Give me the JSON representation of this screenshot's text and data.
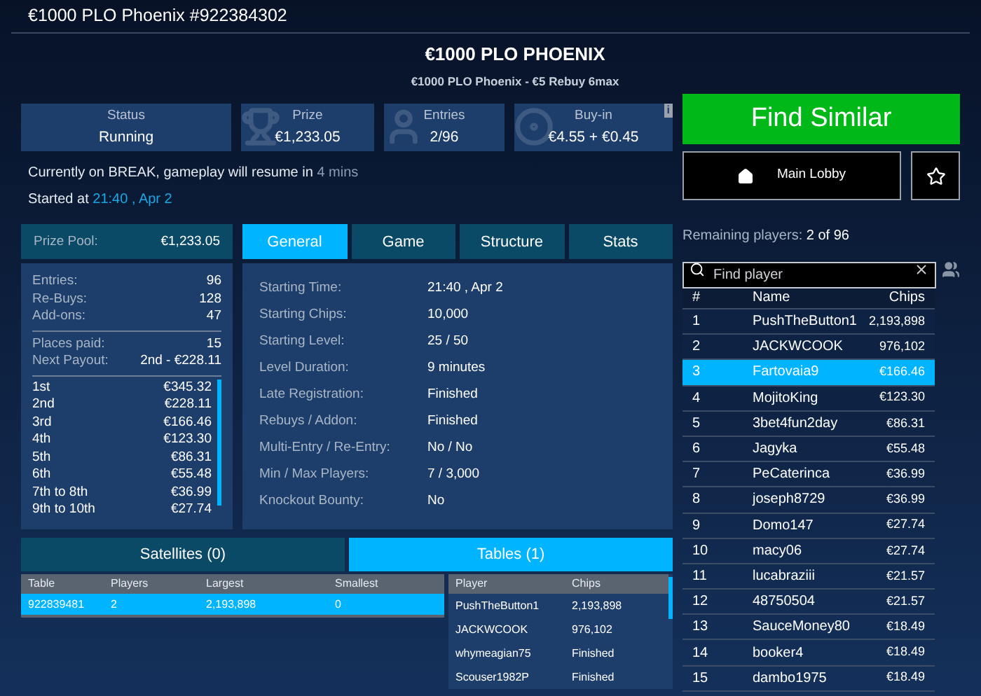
{
  "window": {
    "title": "€1000 PLO Phoenix #922384302"
  },
  "header": {
    "title": "€1000 PLO PHOENIX",
    "subtitle": "€1000 PLO Phoenix - €5 Rebuy 6max"
  },
  "stats": [
    {
      "kind": "plain",
      "label": "Status",
      "value": "Running"
    },
    {
      "kind": "trophy",
      "label": "Prize",
      "value": "€1,233.05"
    },
    {
      "kind": "people",
      "label": "Entries",
      "value": "2/96"
    },
    {
      "kind": "chip",
      "label": "Buy-in",
      "value": "€4.55 + €0.45",
      "info": "i"
    }
  ],
  "notice": {
    "text": "Currently on BREAK, gameplay will resume in",
    "highlight": "4 mins"
  },
  "started": {
    "label": "Started at",
    "value": "21:40 , Apr 2"
  },
  "prize_pool": {
    "label": "Prize Pool:",
    "value": "€1,233.05"
  },
  "counts": [
    {
      "label": "Entries:",
      "value": "96"
    },
    {
      "label": "Re-Buys:",
      "value": "128"
    },
    {
      "label": "Add-ons:",
      "value": "47"
    }
  ],
  "payout_info": [
    {
      "label": "Places paid:",
      "value": "15"
    },
    {
      "label": "Next Payout:",
      "value": "2nd - €228.11"
    }
  ],
  "payouts": [
    {
      "place": "1st",
      "amount": "€345.32"
    },
    {
      "place": "2nd",
      "amount": "€228.11"
    },
    {
      "place": "3rd",
      "amount": "€166.46"
    },
    {
      "place": "4th",
      "amount": "€123.30"
    },
    {
      "place": "5th",
      "amount": "€86.31"
    },
    {
      "place": "6th",
      "amount": "€55.48"
    },
    {
      "place": "7th to 8th",
      "amount": "€36.99"
    },
    {
      "place": "9th to 10th",
      "amount": "€27.74"
    }
  ],
  "tabs": [
    {
      "label": "General",
      "selected": true
    },
    {
      "label": "Game",
      "selected": false
    },
    {
      "label": "Structure",
      "selected": false
    },
    {
      "label": "Stats",
      "selected": false
    }
  ],
  "general": [
    {
      "label": "Starting Time:",
      "value": "21:40 , Apr 2"
    },
    {
      "label": "Starting Chips:",
      "value": "10,000"
    },
    {
      "label": "Starting Level:",
      "value": "25 / 50"
    },
    {
      "label": "Level Duration:",
      "value": "9 minutes"
    },
    {
      "label": "Late Registration:",
      "value": "Finished"
    },
    {
      "label": "Rebuys / Addon:",
      "value": "Finished"
    },
    {
      "label": "Multi-Entry / Re-Entry:",
      "value": "No / No"
    },
    {
      "label": "Min / Max Players:",
      "value": "7 / 3,000"
    },
    {
      "label": "Knockout Bounty:",
      "value": "No"
    }
  ],
  "bottom_tabs": [
    {
      "label": "Satellites (0)",
      "selected": false
    },
    {
      "label": "Tables (1)",
      "selected": true
    }
  ],
  "tables": {
    "columns": [
      "Table",
      "Players",
      "Largest",
      "Smallest"
    ],
    "rows": [
      {
        "cells": [
          "922839481",
          "2",
          "2,193,898",
          "0"
        ],
        "selected": true
      }
    ]
  },
  "table_players": {
    "columns": [
      "Player",
      "Chips"
    ],
    "rows": [
      [
        "PushTheButton1",
        "2,193,898"
      ],
      [
        "JACKWCOOK",
        "976,102"
      ],
      [
        "whymeagian75",
        "Finished"
      ],
      [
        "Scouser1982P",
        "Finished"
      ]
    ]
  },
  "actions": {
    "find_similar": "Find Similar",
    "main_lobby": "Main Lobby"
  },
  "remaining": {
    "label": "Remaining players:",
    "value": "2 of 96"
  },
  "search": {
    "placeholder": "Find player"
  },
  "players": {
    "columns": [
      "#",
      "Name",
      "Chips"
    ],
    "rows": [
      {
        "rank": "1",
        "name": "PushTheButton1",
        "chips": "2,193,898",
        "selected": false
      },
      {
        "rank": "2",
        "name": "JACKWCOOK",
        "chips": "976,102",
        "selected": false
      },
      {
        "rank": "3",
        "name": "Fartovaia9",
        "chips": "€166.46",
        "selected": true
      },
      {
        "rank": "4",
        "name": "MojitoKing",
        "chips": "€123.30",
        "selected": false
      },
      {
        "rank": "5",
        "name": "3bet4fun2day",
        "chips": "€86.31",
        "selected": false
      },
      {
        "rank": "6",
        "name": "Jagyka",
        "chips": "€55.48",
        "selected": false
      },
      {
        "rank": "7",
        "name": "PeCaterinca",
        "chips": "€36.99",
        "selected": false
      },
      {
        "rank": "8",
        "name": "joseph8729",
        "chips": "€36.99",
        "selected": false
      },
      {
        "rank": "9",
        "name": "Domo147",
        "chips": "€27.74",
        "selected": false
      },
      {
        "rank": "10",
        "name": "macy06",
        "chips": "€27.74",
        "selected": false
      },
      {
        "rank": "11",
        "name": "lucabraziii",
        "chips": "€21.57",
        "selected": false
      },
      {
        "rank": "12",
        "name": "48750504",
        "chips": "€21.57",
        "selected": false
      },
      {
        "rank": "13",
        "name": "SauceMoney80",
        "chips": "€18.49",
        "selected": false
      },
      {
        "rank": "14",
        "name": "booker4",
        "chips": "€18.49",
        "selected": false
      },
      {
        "rank": "15",
        "name": "dambo1975",
        "chips": "€18.49",
        "selected": false
      }
    ]
  }
}
